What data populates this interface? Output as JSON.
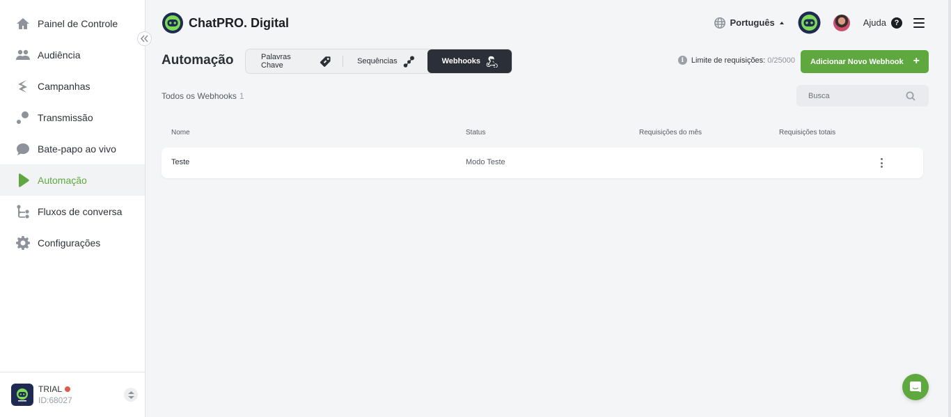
{
  "app": {
    "brand": "ChatPRO. Digital"
  },
  "sidebar": {
    "items": [
      {
        "label": "Painel de Controle",
        "icon": "home-icon"
      },
      {
        "label": "Audiência",
        "icon": "users-icon"
      },
      {
        "label": "Campanhas",
        "icon": "campaign-icon"
      },
      {
        "label": "Transmissão",
        "icon": "broadcast-icon"
      },
      {
        "label": "Bate-papo ao vivo",
        "icon": "chat-bubble-icon"
      },
      {
        "label": "Automação",
        "icon": "play-icon",
        "active": true
      },
      {
        "label": "Fluxos de conversa",
        "icon": "flow-icon"
      },
      {
        "label": "Configurações",
        "icon": "gear-icon"
      }
    ],
    "account": {
      "plan": "TRIAL",
      "id": "ID:68027"
    }
  },
  "header": {
    "language": "Português",
    "help": "Ajuda"
  },
  "page": {
    "title": "Automação",
    "tabs": [
      {
        "label": "Palavras Chave",
        "icon": "tag-icon"
      },
      {
        "label": "Sequências",
        "icon": "sequence-icon"
      },
      {
        "label": "Webhooks",
        "icon": "webhook-icon",
        "active": true
      }
    ],
    "limit_label": "Limite de requisições:",
    "limit_value": "0/25000",
    "add_button": "Adicionar Novo Webhook",
    "list_title": "Todos os Webhooks",
    "list_count": "1",
    "search_placeholder": "Busca"
  },
  "table": {
    "columns": [
      "Nome",
      "Status",
      "Requisições do mês",
      "Requisições totais"
    ],
    "rows": [
      {
        "name": "Teste",
        "status": "Modo Teste",
        "month": "",
        "total": ""
      }
    ]
  },
  "colors": {
    "accent": "#5ea83f",
    "dark": "#2b3038",
    "trial_dot": "#e25a4a"
  }
}
